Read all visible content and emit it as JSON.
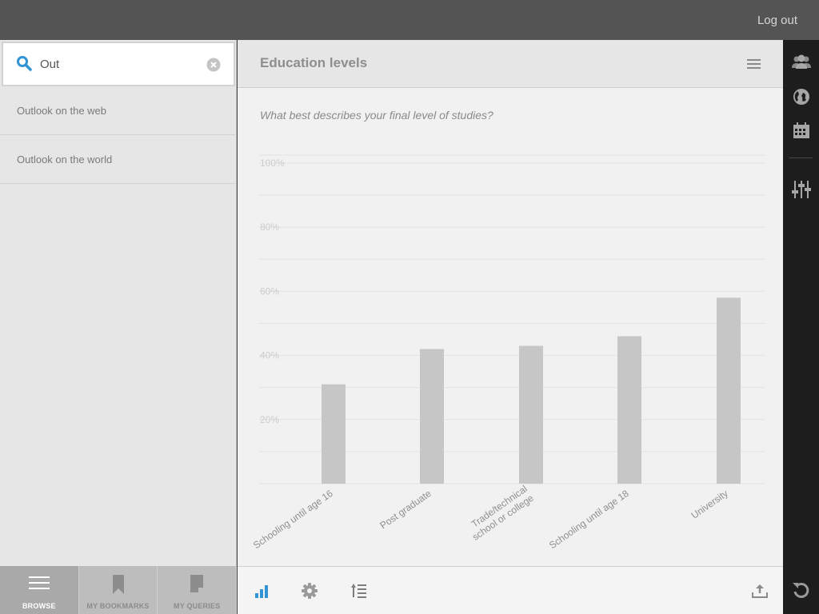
{
  "topbar": {
    "logout_label": "Log out"
  },
  "search": {
    "value": "Out"
  },
  "results": [
    {
      "label": "Outlook on the web"
    },
    {
      "label": "Outlook on the world"
    }
  ],
  "bottom_nav": [
    {
      "label": "BROWSE",
      "icon": "list-icon",
      "active": true
    },
    {
      "label": "MY BOOKMARKS",
      "icon": "bookmark-icon",
      "active": false
    },
    {
      "label": "MY QUERIES",
      "icon": "document-icon",
      "active": false
    }
  ],
  "main": {
    "title": "Education levels",
    "question": "What best describes your final level of studies?"
  },
  "chart_data": {
    "type": "bar",
    "categories": [
      "Schooling until age 16",
      "Post graduate",
      "Trade/technical school or college",
      "Schooling until age 18",
      "University"
    ],
    "category_lines": [
      [
        "Schooling until age 16"
      ],
      [
        "Post graduate"
      ],
      [
        "Trade/technical",
        "school or college"
      ],
      [
        "Schooling until age 18"
      ],
      [
        "University"
      ]
    ],
    "values": [
      31,
      42,
      43,
      46,
      58
    ],
    "y_ticks": [
      "20%",
      "40%",
      "60%",
      "80%",
      "100%"
    ],
    "ylim": [
      0,
      100
    ],
    "grid": true,
    "bar_color": "#c6c6c6"
  },
  "footer_icons": [
    "bar-chart-icon",
    "gear-icon",
    "sort-icon",
    "export-icon"
  ],
  "rail_icons": [
    "people-icon",
    "globe-icon",
    "calendar-icon",
    "sliders-icon",
    "undo-icon"
  ],
  "colors": {
    "accent": "#2f93d6",
    "topbar": "#545454",
    "rail": "#1d1d1d"
  }
}
